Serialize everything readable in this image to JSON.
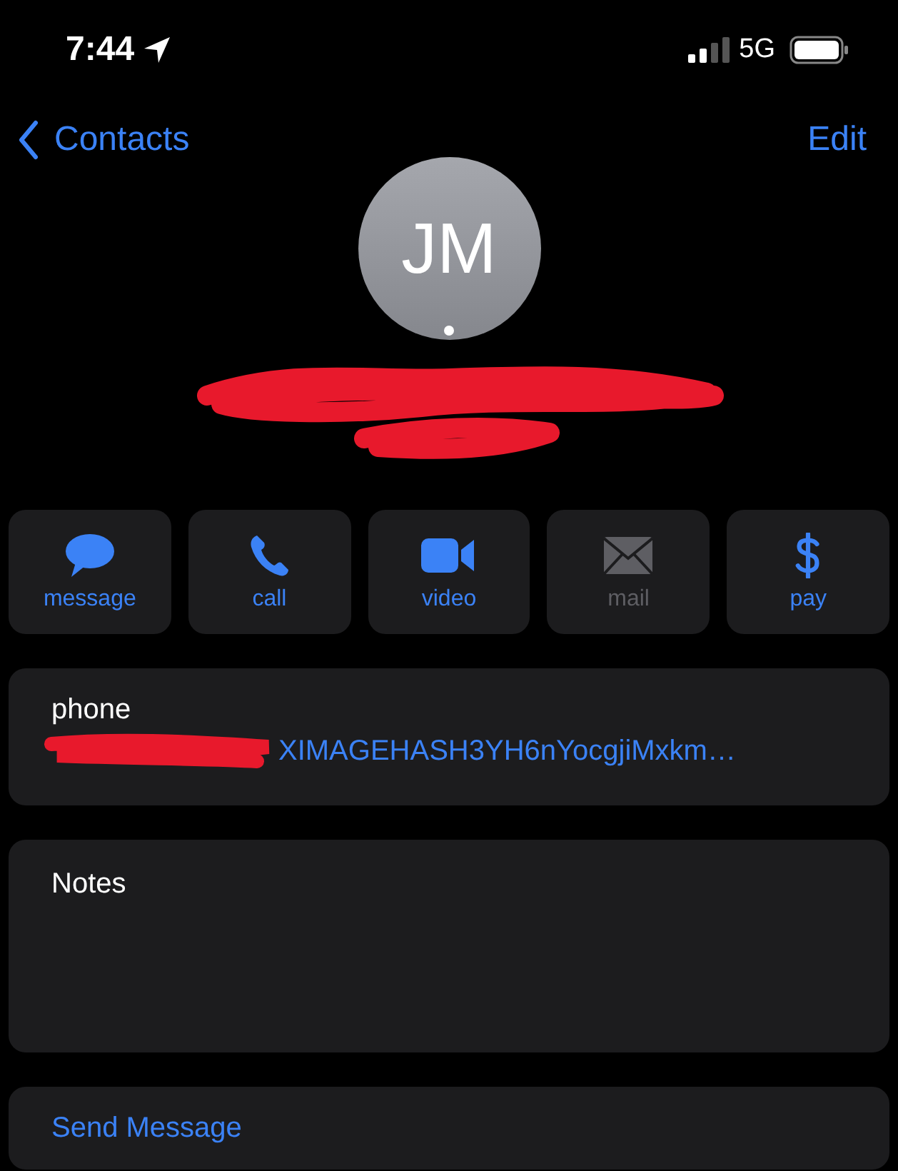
{
  "status_bar": {
    "time": "7:44",
    "network": "5G"
  },
  "nav": {
    "back": "Contacts",
    "edit": "Edit"
  },
  "contact": {
    "initials": "JM"
  },
  "actions": [
    {
      "kind": "message",
      "label": "message",
      "disabled": false
    },
    {
      "kind": "call",
      "label": "call",
      "disabled": false
    },
    {
      "kind": "video",
      "label": "video",
      "disabled": false
    },
    {
      "kind": "mail",
      "label": "mail",
      "disabled": true
    },
    {
      "kind": "pay",
      "label": "pay",
      "disabled": false
    }
  ],
  "phone": {
    "label": "phone",
    "value": "XIMAGEHASH3YH6nYocgjiMxkm…"
  },
  "notes": {
    "label": "Notes"
  },
  "send": {
    "label": "Send Message"
  }
}
